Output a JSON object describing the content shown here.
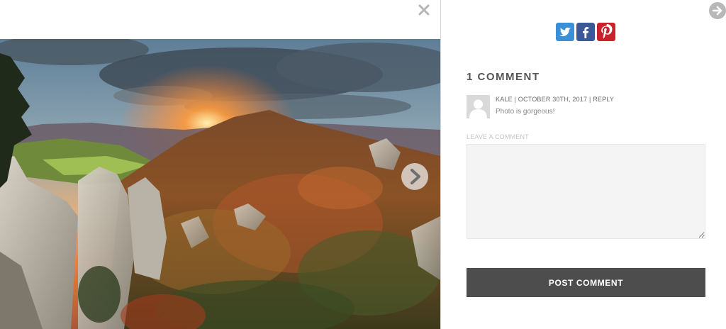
{
  "viewer": {
    "close_symbol": "✕",
    "next_icon": "chevron-right-icon"
  },
  "sidebar": {
    "next_post_icon": "arrow-right-circle-icon",
    "share": [
      {
        "network": "twitter",
        "icon": "twitter-icon",
        "color": "#3b8fd6"
      },
      {
        "network": "facebook",
        "icon": "facebook-icon",
        "color": "#3b5998"
      },
      {
        "network": "pinterest",
        "icon": "pinterest-icon",
        "color": "#c8232c"
      }
    ],
    "comments_heading": "1 COMMENT",
    "comment": {
      "author": "KALE",
      "separator": " | ",
      "date": "OCTOBER 30TH, 2017",
      "reply_label": "REPLY",
      "text": "Photo is gorgeous!"
    },
    "leave_comment_label": "LEAVE A COMMENT",
    "comment_field_value": "",
    "post_button_label": "POST COMMENT"
  }
}
